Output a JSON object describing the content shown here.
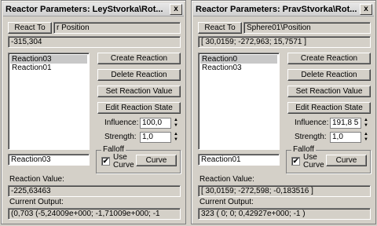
{
  "left": {
    "title": "Reactor Parameters: LeyStvorka\\Rot...",
    "close_glyph": "x",
    "react_to_button": "React To",
    "react_to_value": "r Position",
    "position_value": "-315,304",
    "reactions": [
      "Reaction03",
      "Reaction01"
    ],
    "selected_index": 0,
    "create_reaction": "Create Reaction",
    "delete_reaction": "Delete Reaction",
    "set_reaction_value": "Set Reaction Value",
    "edit_reaction_state": "Edit Reaction State",
    "influence_label": "Influence:",
    "influence_value": "100,0",
    "strength_label": "Strength:",
    "strength_value": "1,0",
    "name_field": "Reaction03",
    "falloff_label": "Falloff",
    "use_curve_label": "Use Curve",
    "curve_button": "Curve",
    "reaction_value_label": "Reaction Value:",
    "reaction_value": "-225,63463",
    "current_output_label": "Current Output:",
    "current_output": "(0,703 (-5,24009e+000; -1,71009e+000; -1"
  },
  "right": {
    "title": "Reactor Parameters: PravStvorka\\Rot...",
    "close_glyph": "x",
    "react_to_button": "React To",
    "react_to_value": "Sphere01\\Position",
    "position_value": "[ 30,0159; -272,963; 15,7571 ]",
    "reactions": [
      "Reaction0",
      "Reaction03"
    ],
    "selected_index": 0,
    "create_reaction": "Create Reaction",
    "delete_reaction": "Delete Reaction",
    "set_reaction_value": "Set Reaction Value",
    "edit_reaction_state": "Edit Reaction State",
    "influence_label": "Influence:",
    "influence_value": "191,8 5",
    "strength_label": "Strength:",
    "strength_value": "1,0",
    "name_field": "Reaction01",
    "falloff_label": "Falloff",
    "use_curve_label": "Use Curve",
    "curve_button": "Curve",
    "reaction_value_label": "Reaction Value:",
    "reaction_value": "[ 30,0159; -272,598; -0,183516 ]",
    "current_output_label": "Current Output:",
    "current_output": "323 ( 0; 0; 0,42927e+000; -1 )"
  },
  "checkbox_glyph": "✔",
  "spinner_up": "▲",
  "spinner_down": "▼"
}
